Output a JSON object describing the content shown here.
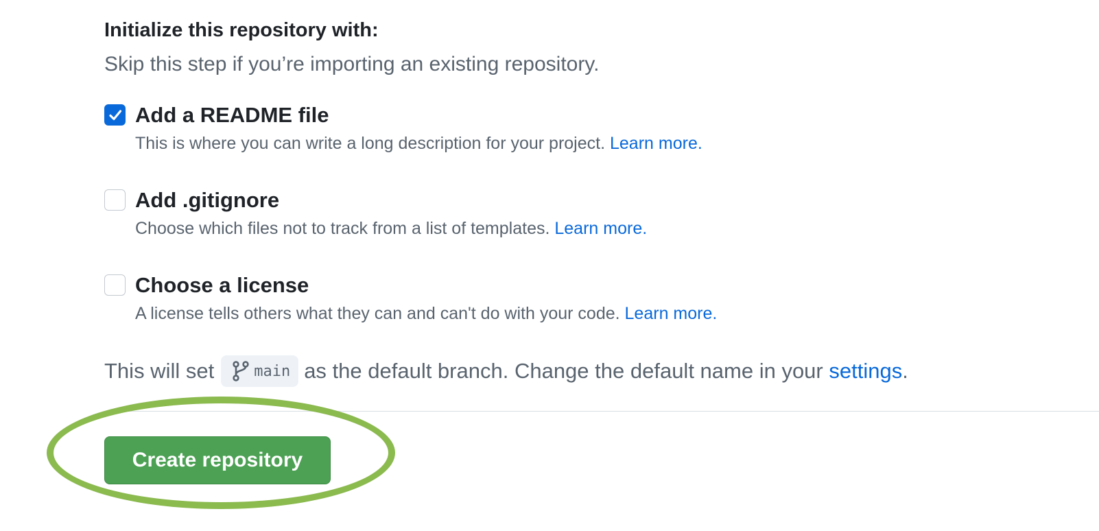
{
  "init_section": {
    "title": "Initialize this repository with:",
    "subtitle": "Skip this step if you’re importing an existing repository."
  },
  "options": [
    {
      "label": "Add a README file",
      "checked": true,
      "description": "This is where you can write a long description for your project.",
      "link": "Learn more."
    },
    {
      "label": "Add .gitignore",
      "checked": false,
      "description": "Choose which files not to track from a list of templates.",
      "link": "Learn more."
    },
    {
      "label": "Choose a license",
      "checked": false,
      "description": "A license tells others what they can and can't do with your code.",
      "link": "Learn more."
    }
  ],
  "branch_notice": {
    "prefix": "This will set",
    "branch_icon": "git-branch-icon",
    "branch_name": "main",
    "middle": "as the default branch. Change the default name in your",
    "settings_link": "settings",
    "suffix": "."
  },
  "actions": {
    "create_label": "Create repository"
  },
  "colors": {
    "primary_button": "#4ca154",
    "link": "#0969da",
    "highlight": "#8bba4f",
    "checkbox_checked": "#0969da"
  }
}
